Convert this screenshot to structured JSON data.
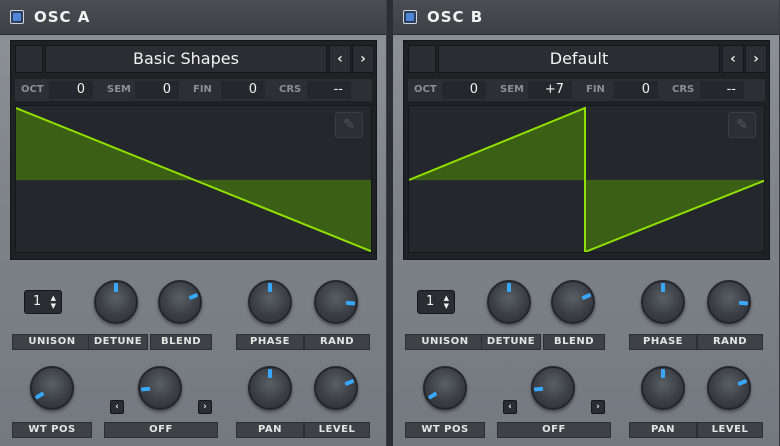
{
  "osc_a": {
    "title": "OSC A",
    "preset": "Basic Shapes",
    "prev_icon": "chevron-left-icon",
    "next_icon": "chevron-right-icon",
    "params": [
      {
        "label": "OCT",
        "value": "0"
      },
      {
        "label": "SEM",
        "value": "0"
      },
      {
        "label": "FIN",
        "value": "0"
      },
      {
        "label": "CRS",
        "value": "--"
      }
    ],
    "unison": "1",
    "labels": {
      "unison": "UNISON",
      "detune": "DETUNE",
      "blend": "BLEND",
      "phase": "PHASE",
      "rand": "RAND",
      "wt_pos": "WT POS",
      "warp": "OFF",
      "pan": "PAN",
      "level": "LEVEL"
    },
    "knob_values": {
      "detune": 0.5,
      "blend": 0.75,
      "phase": 0.5,
      "rand": 0.85,
      "wt_pos": 0.05,
      "warp": 0.15,
      "pan": 0.5,
      "level": 0.75
    }
  },
  "osc_b": {
    "title": "OSC B",
    "preset": "Default",
    "prev_icon": "chevron-left-icon",
    "next_icon": "chevron-right-icon",
    "params": [
      {
        "label": "OCT",
        "value": "0"
      },
      {
        "label": "SEM",
        "value": "+7"
      },
      {
        "label": "FIN",
        "value": "0"
      },
      {
        "label": "CRS",
        "value": "--"
      }
    ],
    "unison": "1",
    "labels": {
      "unison": "UNISON",
      "detune": "DETUNE",
      "blend": "BLEND",
      "phase": "PHASE",
      "rand": "RAND",
      "wt_pos": "WT POS",
      "warp": "OFF",
      "pan": "PAN",
      "level": "LEVEL"
    },
    "knob_values": {
      "detune": 0.5,
      "blend": 0.75,
      "phase": 0.5,
      "rand": 0.85,
      "wt_pos": 0.05,
      "warp": 0.15,
      "pan": 0.5,
      "level": 0.75
    }
  },
  "colors": {
    "accent_blue": "#38a8ff",
    "wave_green": "#8fe000",
    "wave_fill": "#3f6a10"
  }
}
